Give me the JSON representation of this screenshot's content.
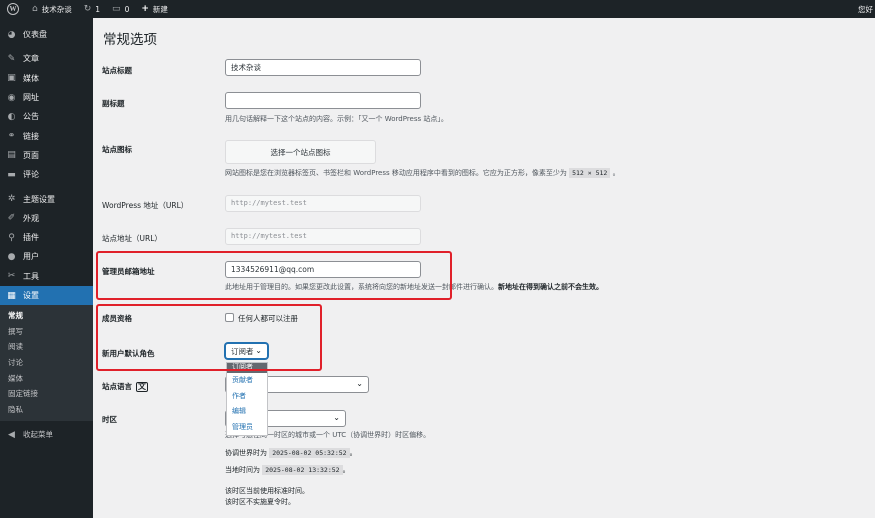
{
  "adminbar": {
    "site_name": "技术杂谈",
    "updates_count": "1",
    "comments_count": "0",
    "new_label": "新建",
    "howdy": "您好"
  },
  "sidebar": {
    "items": [
      {
        "label": "仪表盘",
        "icon": "dashboard-icon",
        "glyph": "◕"
      },
      {
        "label": "文章",
        "icon": "pin-icon",
        "glyph": "✎"
      },
      {
        "label": "媒体",
        "icon": "media-icon",
        "glyph": "▣"
      },
      {
        "label": "网址",
        "icon": "link-manager-icon",
        "glyph": "◉"
      },
      {
        "label": "公告",
        "icon": "megaphone-icon",
        "glyph": "◐"
      },
      {
        "label": "链接",
        "icon": "links-icon",
        "glyph": "⚭"
      },
      {
        "label": "页面",
        "icon": "page-icon",
        "glyph": "▤"
      },
      {
        "label": "评论",
        "icon": "comment-icon",
        "glyph": "▬"
      },
      {
        "label": "主题设置",
        "icon": "theme-settings-icon",
        "glyph": "✲"
      },
      {
        "label": "外观",
        "icon": "appearance-icon",
        "glyph": "✐"
      },
      {
        "label": "插件",
        "icon": "plugin-icon",
        "glyph": "⚲"
      },
      {
        "label": "用户",
        "icon": "users-icon",
        "glyph": "●"
      },
      {
        "label": "工具",
        "icon": "tools-icon",
        "glyph": "✂"
      },
      {
        "label": "设置",
        "icon": "settings-icon",
        "glyph": "▦"
      }
    ],
    "submenu": [
      "常规",
      "撰写",
      "阅读",
      "讨论",
      "媒体",
      "固定链接",
      "隐私"
    ],
    "collapse_label": "收起菜单"
  },
  "page": {
    "title": "常规选项",
    "site_title": {
      "label": "站点标题",
      "value": "技术杂谈"
    },
    "tagline": {
      "label": "副标题",
      "value": "",
      "desc": "用几句话解释一下这个站点的内容。示例：「又一个 WordPress 站点」。"
    },
    "site_icon": {
      "label": "站点图标",
      "button": "选择一个站点图标",
      "desc_before": "网站图标是您在浏览器标签页、书签栏和 WordPress 移动应用程序中看到的图标。它应为正方形，像素至少为",
      "desc_code": "512 × 512",
      "desc_after": "。"
    },
    "wp_address": {
      "label": "WordPress 地址（URL）",
      "value": "http://mytest.test"
    },
    "site_address": {
      "label": "站点地址（URL）",
      "value": "http://mytest.test"
    },
    "admin_email": {
      "label": "管理员邮箱地址",
      "value": "1334526911@qq.com",
      "desc_before": "此地址用于管理目的。如果您更改此设置，系统将向您的新地址发送一封邮件进行确认。",
      "desc_strong": "新地址在得到确认之前不会生效。"
    },
    "membership": {
      "label": "成员资格",
      "checkbox_label": "任何人都可以注册",
      "checked": false
    },
    "default_role": {
      "label": "新用户默认角色",
      "selected": "订阅者",
      "options": [
        "订阅者",
        "贡献者",
        "作者",
        "编辑",
        "管理员"
      ]
    },
    "site_language": {
      "label": "站点语言"
    },
    "timezone": {
      "label": "时区",
      "desc": "选择与您在同一时区的城市或一个 UTC（协调世界时）时区偏移。",
      "utc_label": "协调世界时为",
      "utc_value": "2025-08-02 05:32:52",
      "local_label": "当地时间为",
      "local_value": "2025-08-02 13:32:52",
      "suffix": "。",
      "std_note": "该时区当前使用标准时间。",
      "dst_note": "该时区不实施夏令时。"
    }
  },
  "colors": {
    "adminbar_bg": "#1d2327",
    "accent": "#2271b1",
    "highlight_box": "#e0202a",
    "page_bg": "#f0f0f1"
  }
}
